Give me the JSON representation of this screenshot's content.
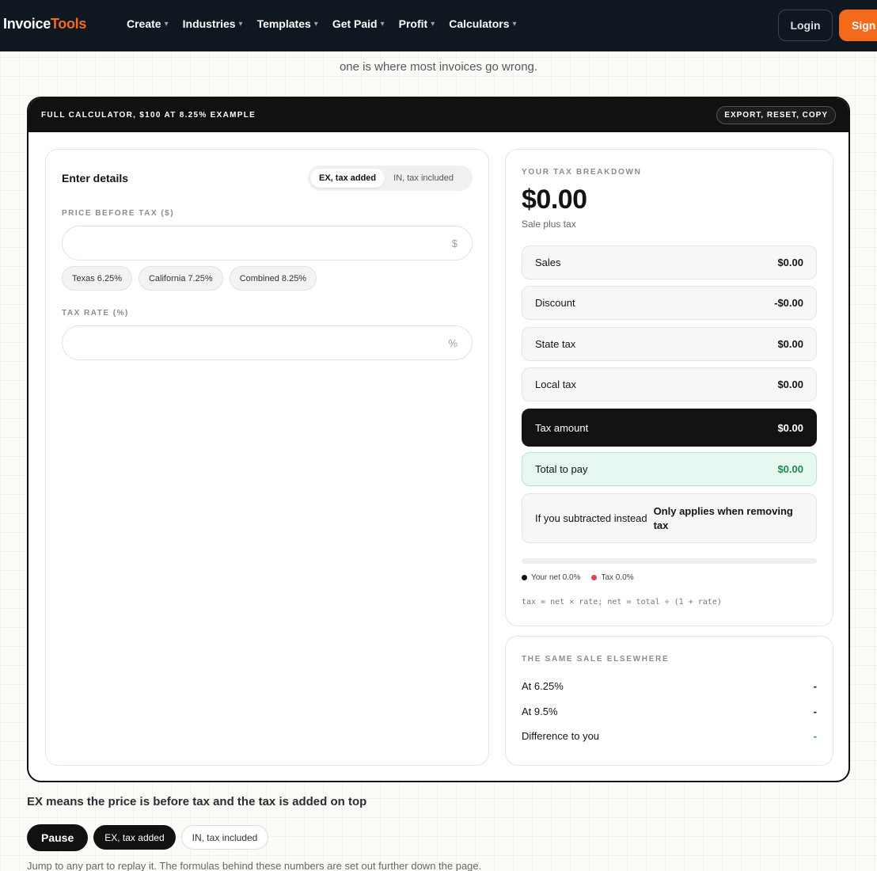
{
  "nav": {
    "logo_main": "Invoice",
    "logo_accent": "Tools",
    "menu": [
      {
        "label": "Create"
      },
      {
        "label": "Industries"
      },
      {
        "label": "Templates"
      },
      {
        "label": "Get Paid"
      },
      {
        "label": "Profit"
      },
      {
        "label": "Calculators"
      }
    ],
    "caret": "▾",
    "login": "Login",
    "signup": "Sign"
  },
  "intro": {
    "line": "one is where most invoices go wrong."
  },
  "calculator": {
    "title": "FULL CALCULATOR, $100 AT 8.25% EXAMPLE",
    "actions": "EXPORT, RESET, COPY",
    "left": {
      "heading": "Enter details",
      "modes": [
        "EX, tax added",
        "IN, tax included"
      ],
      "price_label": "PRICE BEFORE TAX ($)",
      "price_value": "",
      "price_suffix": "$",
      "presets": [
        "Texas 6.25%",
        "California 7.25%",
        "Combined 8.25%"
      ],
      "rate_label": "TAX RATE (%)",
      "rate_value": "",
      "rate_suffix": "%"
    },
    "breakdown": {
      "kicker": "YOUR TAX BREAKDOWN",
      "total": "$0.00",
      "total_sub": "Sale plus tax",
      "rows": [
        {
          "label": "Sales",
          "value": "$0.00"
        },
        {
          "label": "Discount",
          "value": "-$0.00"
        },
        {
          "label": "State tax",
          "value": "$0.00"
        },
        {
          "label": "Local tax",
          "value": "$0.00"
        },
        {
          "label": "Tax amount",
          "value": "$0.00"
        },
        {
          "label": "Total to pay",
          "value": "$0.00"
        }
      ],
      "note_label": "If you subtracted instead",
      "note_value": "Only applies when removing tax",
      "progress_net_pct": 0,
      "legend_net": "Your net 0.0%",
      "legend_tax": "Tax 0.0%",
      "formula": "tax = net × rate; net = total ÷ (1 + rate)",
      "colors": {
        "net": "#111111",
        "tax": "#e04848"
      }
    },
    "elsewhere": {
      "kicker": "THE SAME SALE ELSEWHERE",
      "rows": [
        {
          "label": "At 6.25%",
          "value": "-"
        },
        {
          "label": "At 9.5%",
          "value": "-"
        },
        {
          "label": "Difference to you",
          "value": "-"
        }
      ]
    }
  },
  "bottom": {
    "title": "EX means the price is before tax and the tax is added on top",
    "pause": "Pause",
    "pill_ex": "EX, tax added",
    "pill_in": "IN, tax included",
    "note": "Jump to any part to replay it. The formulas behind these numbers are set out further down the page."
  }
}
